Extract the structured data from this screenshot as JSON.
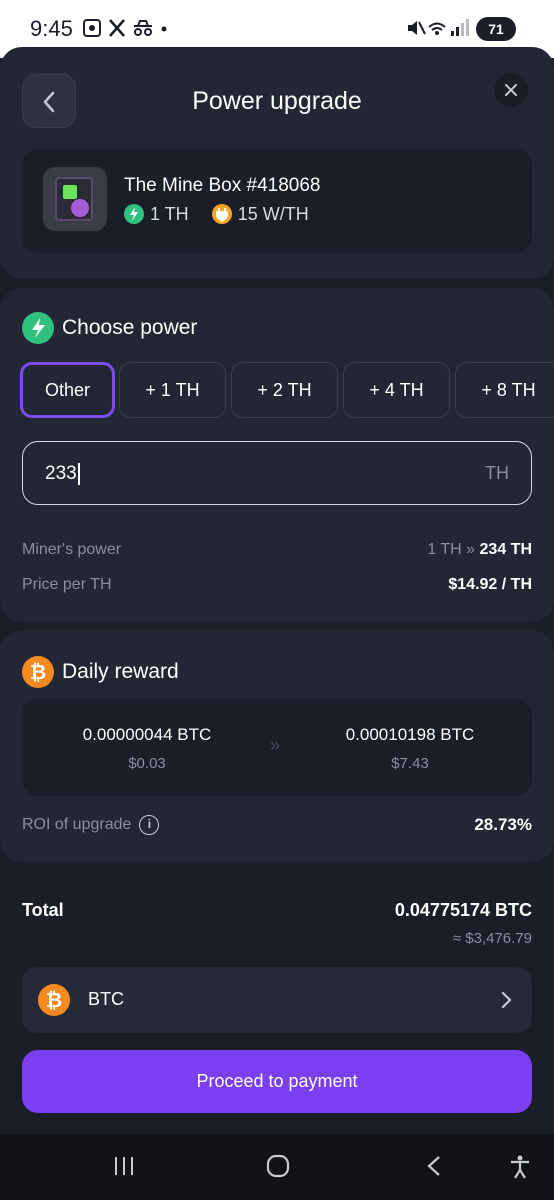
{
  "status_bar": {
    "time": "9:45",
    "battery": "71"
  },
  "header": {
    "title": "Power upgrade"
  },
  "product": {
    "name": "The Mine Box #418068",
    "power": "1 TH",
    "efficiency": "15 W/TH"
  },
  "choose_power": {
    "title": "Choose power",
    "options": [
      "Other",
      "+ 1 TH",
      "+ 2 TH",
      "+ 4 TH",
      "+ 8 TH"
    ],
    "selected": "Other",
    "input_value": "233",
    "input_unit": "TH",
    "miners_power_label": "Miner's power",
    "miners_power_from": "1 TH",
    "miners_power_to": "234 TH",
    "price_label": "Price per TH",
    "price_value": "$14.92 / TH"
  },
  "daily_reward": {
    "title": "Daily reward",
    "current_btc": "0.00000044 BTC",
    "current_usd": "$0.03",
    "new_btc": "0.00010198 BTC",
    "new_usd": "$7.43",
    "roi_label": "ROI of upgrade",
    "roi_value": "28.73%"
  },
  "total": {
    "label": "Total",
    "btc": "0.04775174 BTC",
    "usd": "≈ $3,476.79"
  },
  "payment": {
    "currency": "BTC",
    "button_label": "Proceed to payment"
  },
  "colors": {
    "accent": "#7b3ff2",
    "background": "#1b1e29",
    "card": "#232634",
    "green": "#2ec27e",
    "orange": "#f5a623",
    "btc": "#f38b20"
  }
}
